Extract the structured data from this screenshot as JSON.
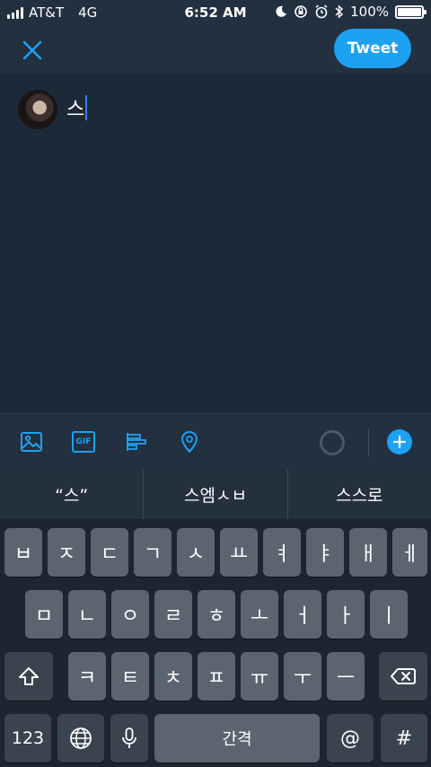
{
  "status_bar": {
    "carrier": "AT&T",
    "network": "4G",
    "time": "6:52 AM",
    "battery": "100%",
    "icons": [
      "moon-icon",
      "rotation-lock-icon",
      "alarm-icon",
      "bluetooth-icon"
    ]
  },
  "nav": {
    "close_icon": "close-icon",
    "tweet_label": "Tweet"
  },
  "compose": {
    "text": "스"
  },
  "toolbar": {
    "icons": [
      "image-icon",
      "gif-icon",
      "poll-icon",
      "location-icon",
      "add-icon"
    ],
    "gif_label": "GIF"
  },
  "suggestions": [
    "“스”",
    "스엠ㅅㅂ",
    "스스로"
  ],
  "keyboard": {
    "row1": [
      "ㅂ",
      "ㅈ",
      "ㄷ",
      "ㄱ",
      "ㅅ",
      "ㅛ",
      "ㅕ",
      "ㅑ",
      "ㅐ",
      "ㅔ"
    ],
    "row2": [
      "ㅁ",
      "ㄴ",
      "ㅇ",
      "ㄹ",
      "ㅎ",
      "ㅗ",
      "ㅓ",
      "ㅏ",
      "ㅣ"
    ],
    "row3": [
      "ㅋ",
      "ㅌ",
      "ㅊ",
      "ㅍ",
      "ㅠ",
      "ㅜ",
      "ㅡ"
    ],
    "numbers_label": "123",
    "space_label": "간격",
    "at_label": "@",
    "hash_label": "#"
  },
  "colors": {
    "accent": "#1da1f2",
    "background": "#1c2938",
    "bar": "#22303f",
    "key": "#5b6570",
    "key_dark": "#3a444f"
  }
}
